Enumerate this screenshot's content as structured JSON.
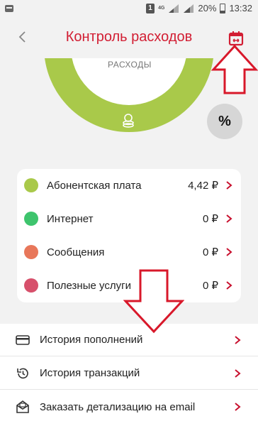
{
  "status_bar": {
    "sim_label": "1",
    "network": "4G",
    "battery": "20%",
    "time": "13:32"
  },
  "header": {
    "title": "Контроль расходов"
  },
  "donut": {
    "label": "РАСХОДЫ",
    "color": "#a9c94a"
  },
  "percent_button": {
    "label": "%"
  },
  "categories": [
    {
      "label": "Абонентская плата",
      "value": "4,42 ₽",
      "color": "#a9c94a"
    },
    {
      "label": "Интернет",
      "value": "0 ₽",
      "color": "#3ec46d"
    },
    {
      "label": "Сообщения",
      "value": "0 ₽",
      "color": "#e8775a"
    },
    {
      "label": "Полезные услуги",
      "value": "0 ₽",
      "color": "#d7506b"
    }
  ],
  "bottom_list": [
    {
      "label": "История пополнений",
      "icon": "card-icon"
    },
    {
      "label": "История транзакций",
      "icon": "history-icon"
    },
    {
      "label": "Заказать детализацию на email",
      "icon": "mail-icon"
    }
  ],
  "colors": {
    "accent": "#d21e33",
    "chevron": "#c8102e",
    "background": "#f2f2f2"
  }
}
